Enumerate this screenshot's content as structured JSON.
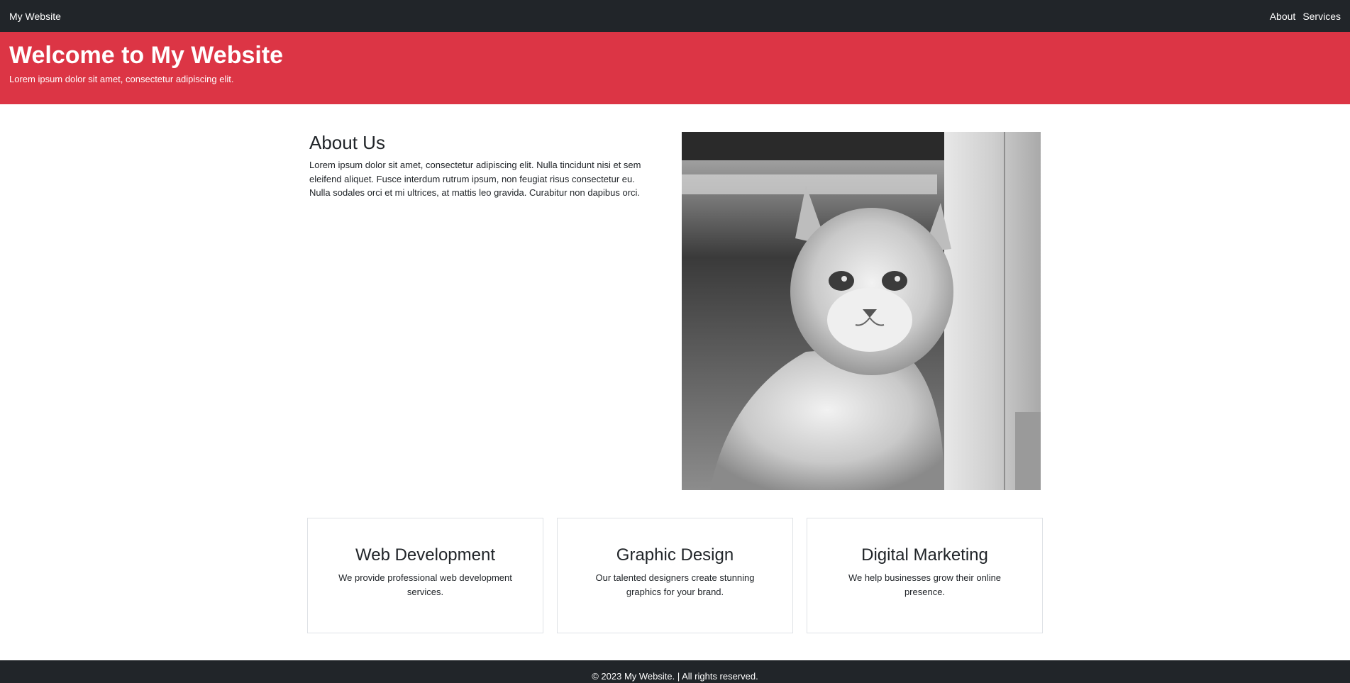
{
  "navbar": {
    "brand": "My Website",
    "links": [
      {
        "label": "About"
      },
      {
        "label": "Services"
      }
    ]
  },
  "hero": {
    "title": "Welcome to My Website",
    "subtitle": "Lorem ipsum dolor sit amet, consectetur adipiscing elit."
  },
  "about": {
    "title": "About Us",
    "body": "Lorem ipsum dolor sit amet, consectetur adipiscing elit. Nulla tincidunt nisi et sem eleifend aliquet. Fusce interdum rutrum ipsum, non feugiat risus consectetur eu. Nulla sodales orci et mi ultrices, at mattis leo gravida. Curabitur non dapibus orci."
  },
  "image": {
    "subject": "grayscale-kitten-photo"
  },
  "services": [
    {
      "title": "Web Development",
      "description": "We provide professional web development services."
    },
    {
      "title": "Graphic Design",
      "description": "Our talented designers create stunning graphics for your brand."
    },
    {
      "title": "Digital Marketing",
      "description": "We help businesses grow their online presence."
    }
  ],
  "footer": {
    "text": "© 2023 My Website.  |  All rights reserved."
  },
  "colors": {
    "navbar": "#212529",
    "hero": "#dc3545",
    "footer": "#212529"
  }
}
